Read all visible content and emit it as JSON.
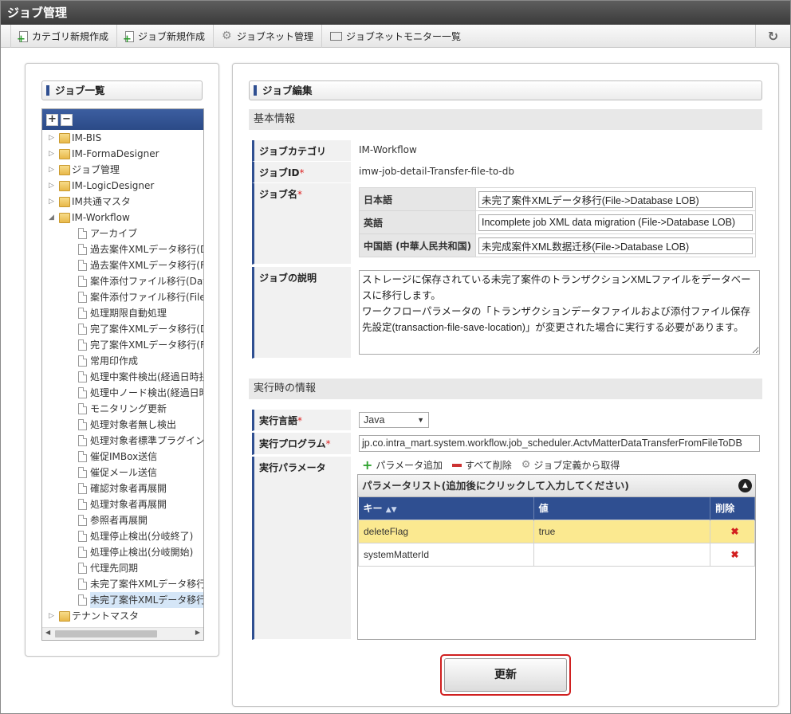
{
  "app": {
    "title": "ジョブ管理"
  },
  "toolbar": {
    "items": [
      {
        "label": "カテゴリ新規作成",
        "icon": "new-category-icon"
      },
      {
        "label": "ジョブ新規作成",
        "icon": "new-job-icon"
      },
      {
        "label": "ジョブネット管理",
        "icon": "gear-icon"
      },
      {
        "label": "ジョブネットモニター一覧",
        "icon": "monitor-icon"
      }
    ],
    "refresh_icon": "refresh-icon"
  },
  "left": {
    "header": "ジョブ一覧",
    "tree": [
      {
        "label": "IM-BIS",
        "type": "folder",
        "level": 0,
        "expanded": false
      },
      {
        "label": "IM-FormaDesigner",
        "type": "folder",
        "level": 0,
        "expanded": false
      },
      {
        "label": "ジョブ管理",
        "type": "folder",
        "level": 0,
        "expanded": false
      },
      {
        "label": "IM-LogicDesigner",
        "type": "folder",
        "level": 0,
        "expanded": false
      },
      {
        "label": "IM共通マスタ",
        "type": "folder",
        "level": 0,
        "expanded": false
      },
      {
        "label": "IM-Workflow",
        "type": "folder",
        "level": 0,
        "expanded": true
      },
      {
        "label": "アーカイブ",
        "type": "file",
        "level": 1
      },
      {
        "label": "過去案件XMLデータ移行(D",
        "type": "file",
        "level": 1
      },
      {
        "label": "過去案件XMLデータ移行(F",
        "type": "file",
        "level": 1
      },
      {
        "label": "案件添付ファイル移行(Data",
        "type": "file",
        "level": 1
      },
      {
        "label": "案件添付ファイル移行(File-",
        "type": "file",
        "level": 1
      },
      {
        "label": "処理期限自動処理",
        "type": "file",
        "level": 1
      },
      {
        "label": "完了案件XMLデータ移行(D",
        "type": "file",
        "level": 1
      },
      {
        "label": "完了案件XMLデータ移行(F",
        "type": "file",
        "level": 1
      },
      {
        "label": "常用印作成",
        "type": "file",
        "level": 1
      },
      {
        "label": "処理中案件検出(経過日時拐",
        "type": "file",
        "level": 1
      },
      {
        "label": "処理中ノード検出(経過日時",
        "type": "file",
        "level": 1
      },
      {
        "label": "モニタリング更新",
        "type": "file",
        "level": 1
      },
      {
        "label": "処理対象者無し検出",
        "type": "file",
        "level": 1
      },
      {
        "label": "処理対象者標準プラグイン網",
        "type": "file",
        "level": 1
      },
      {
        "label": "催促IMBox送信",
        "type": "file",
        "level": 1
      },
      {
        "label": "催促メール送信",
        "type": "file",
        "level": 1
      },
      {
        "label": "確認対象者再展開",
        "type": "file",
        "level": 1
      },
      {
        "label": "処理対象者再展開",
        "type": "file",
        "level": 1
      },
      {
        "label": "参照者再展開",
        "type": "file",
        "level": 1
      },
      {
        "label": "処理停止検出(分岐終了)",
        "type": "file",
        "level": 1
      },
      {
        "label": "処理停止検出(分岐開始)",
        "type": "file",
        "level": 1
      },
      {
        "label": "代理先同期",
        "type": "file",
        "level": 1
      },
      {
        "label": "未完了案件XMLデータ移行",
        "type": "file",
        "level": 1
      },
      {
        "label": "未完了案件XMLデータ移行",
        "type": "file",
        "level": 1,
        "selected": true
      },
      {
        "label": "テナントマスタ",
        "type": "folder",
        "level": 0,
        "expanded": false
      }
    ]
  },
  "right": {
    "header": "ジョブ編集",
    "basic": {
      "title": "基本情報",
      "category_label": "ジョブカテゴリ",
      "category_value": "IM-Workflow",
      "id_label": "ジョブID",
      "id_value": "imw-job-detail-Transfer-file-to-db",
      "name_label": "ジョブ名",
      "names": [
        {
          "lang": "日本語",
          "value": "未完了案件XMLデータ移行(File->Database LOB)"
        },
        {
          "lang": "英語",
          "value": "Incomplete job XML data migration (File->Database LOB)"
        },
        {
          "lang": "中国語 (中華人民共和国)",
          "value": "未完成案件XML数据迁移(File->Database LOB)"
        }
      ],
      "desc_label": "ジョブの説明",
      "desc_value": "ストレージに保存されている未完了案件のトランザクションXMLファイルをデータベースに移行します。\nワークフローパラメータの「トランザクションデータファイルおよび添付ファイル保存先設定(transaction-file-save-location)」が変更された場合に実行する必要があります。",
      "required_mark": "*"
    },
    "runtime": {
      "title": "実行時の情報",
      "lang_label": "実行言語",
      "lang_value": "Java",
      "program_label": "実行プログラム",
      "program_value": "jp.co.intra_mart.system.workflow.job_scheduler.ActvMatterDataTransferFromFileToDB",
      "param_label": "実行パラメータ",
      "actions": {
        "add": "パラメータ追加",
        "delete_all": "すべて削除",
        "fetch": "ジョブ定義から取得"
      },
      "param_list_title": "パラメータリスト(追加後にクリックして入力してください)",
      "columns": {
        "key": "キー",
        "value": "値",
        "delete": "削除"
      },
      "params": [
        {
          "key": "deleteFlag",
          "value": "true"
        },
        {
          "key": "systemMatterId",
          "value": ""
        }
      ]
    },
    "update_button": "更新"
  },
  "colors": {
    "accent": "#2f4f91",
    "highlight_row": "#fbe990",
    "danger": "#d21f1f"
  }
}
